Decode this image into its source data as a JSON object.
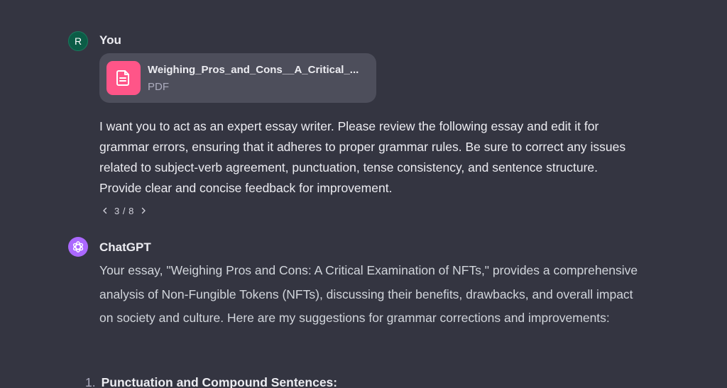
{
  "user": {
    "avatar_initial": "R",
    "name": "You"
  },
  "attachment": {
    "file_name": "Weighing_Pros_and_Cons__A_Critical_...",
    "file_type": "PDF",
    "icon": "document-icon",
    "icon_color": "#ff5588"
  },
  "user_message": "I want you to act as an expert essay writer. Please review the following essay and edit it for grammar errors, ensuring that it adheres to proper grammar rules. Be sure to correct any issues related to subject-verb agreement, punctuation, tense consistency, and sentence structure. Provide clear and concise feedback for improvement.",
  "pager": {
    "prev_icon": "chevron-left-icon",
    "count": "3 / 8",
    "next_icon": "chevron-right-icon"
  },
  "assistant": {
    "name": "ChatGPT",
    "avatar_color": "#ab68ff",
    "intro": "Your essay, \"Weighing Pros and Cons: A Critical Examination of NFTs,\" provides a comprehensive analysis of Non-Fungible Tokens (NFTs), discussing their benefits, drawbacks, and overall impact on society and culture. Here are my suggestions for grammar corrections and improvements:",
    "list": [
      {
        "number": "1.",
        "heading": "Punctuation and Compound Sentences:"
      }
    ]
  },
  "colors": {
    "background": "#343541",
    "user_avatar": "#0b5c46",
    "card": "#4d4e5b"
  }
}
